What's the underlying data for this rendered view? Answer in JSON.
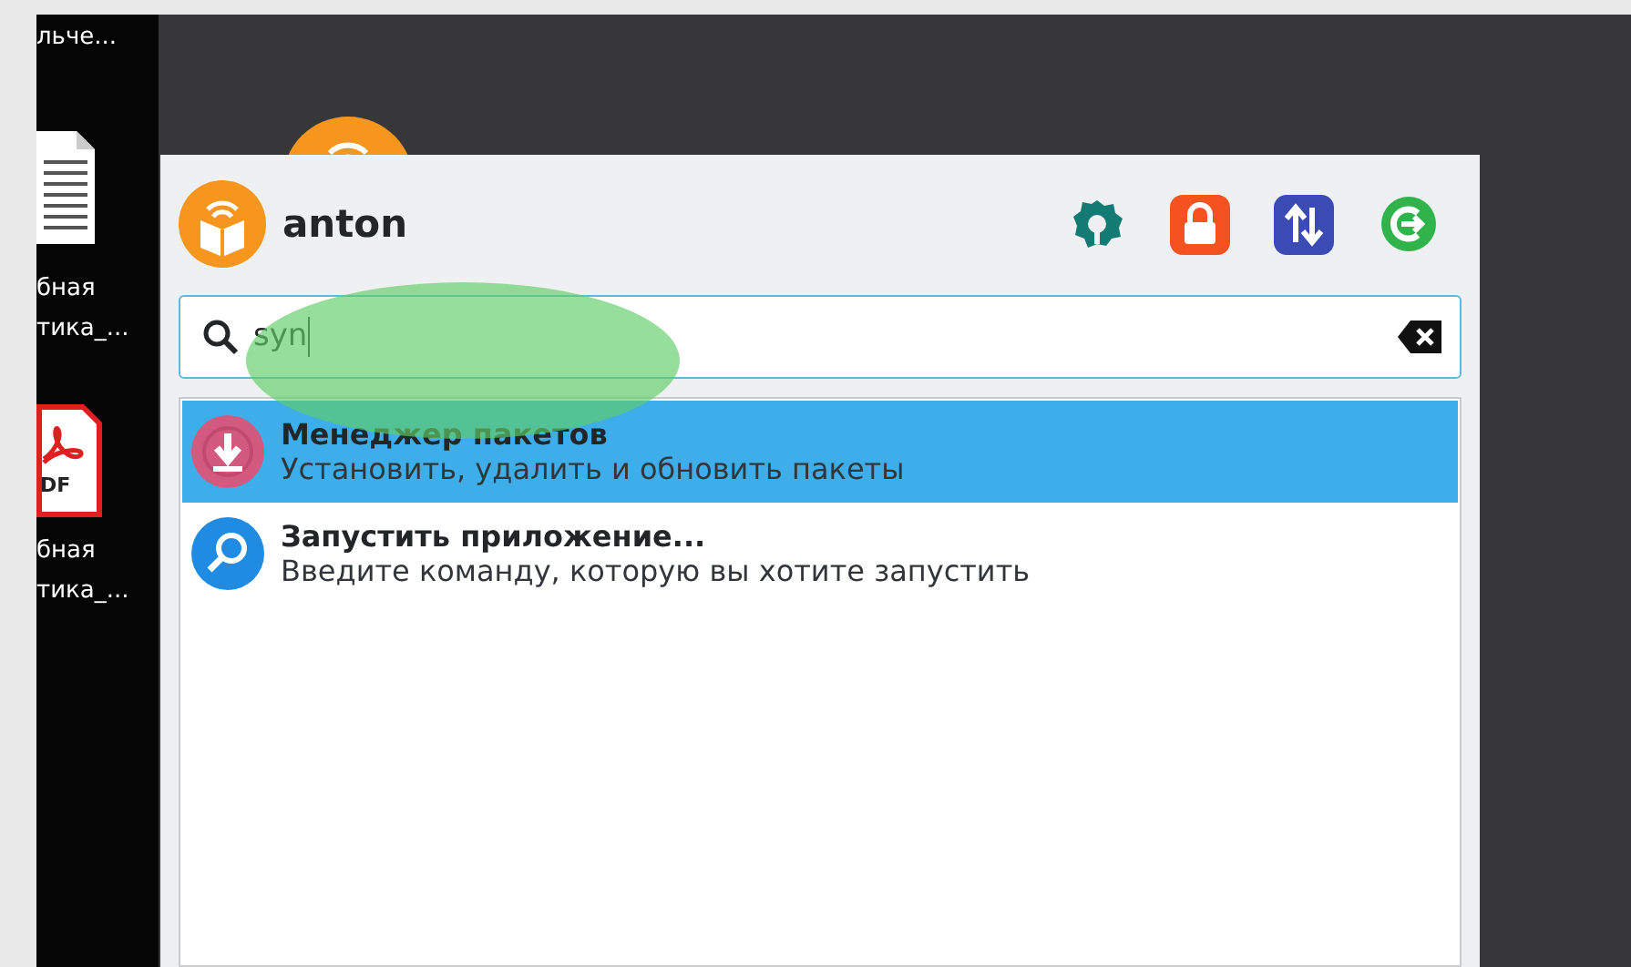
{
  "desktop_icons": [
    {
      "kind": "none",
      "label": "льче..."
    },
    {
      "kind": "document",
      "label": "бная\nтика_..."
    },
    {
      "kind": "pdf",
      "badge": "DF",
      "label": "бная\nтика_..."
    }
  ],
  "menu": {
    "user": "anton",
    "actions": [
      {
        "kind": "settings"
      },
      {
        "kind": "lock"
      },
      {
        "kind": "switch-user"
      },
      {
        "kind": "logout"
      }
    ],
    "search": {
      "value": "syn"
    },
    "results": [
      {
        "kind": "package",
        "title": "Менеджер пакетов",
        "subtitle": "Установить, удалить и обновить пакеты",
        "selected": true
      },
      {
        "kind": "run",
        "title": "Запустить приложение...",
        "subtitle": "Введите команду, которую вы хотите запустить",
        "selected": false
      }
    ]
  }
}
